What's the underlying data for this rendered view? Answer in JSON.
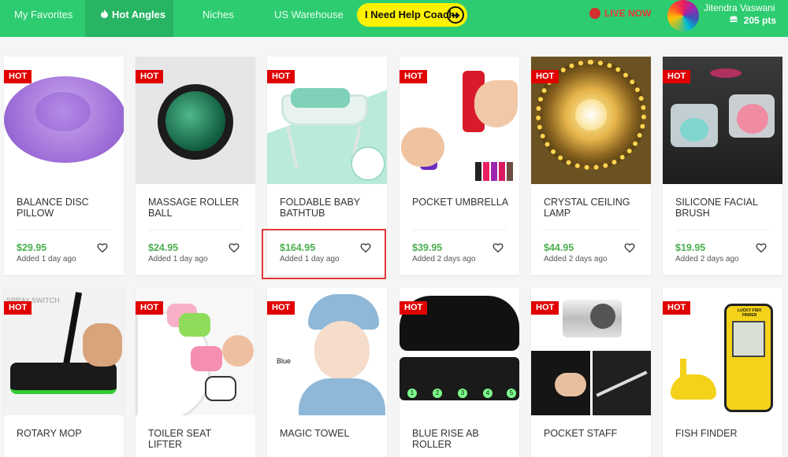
{
  "nav": {
    "tabs": [
      {
        "label": "My Favorites",
        "icon": ""
      },
      {
        "label": "Hot Angles",
        "icon": "fire-icon"
      },
      {
        "label": "Niches",
        "icon": ""
      },
      {
        "label": "US Warehouse",
        "icon": ""
      }
    ],
    "help_label": "I Need Help Coach",
    "live_label": "LIVE NOW",
    "user_name": "Jitendra Vaswani",
    "user_points": "205 pts"
  },
  "products": [
    {
      "title": "BALANCE DISC PILLOW",
      "price": "$29.95",
      "added": "Added 1 day ago",
      "hot": "HOT"
    },
    {
      "title": "MASSAGE ROLLER BALL",
      "price": "$24.95",
      "added": "Added 1 day ago",
      "hot": "HOT"
    },
    {
      "title": "FOLDABLE BABY BATHTUB",
      "price": "$164.95",
      "added": "Added 1 day ago",
      "hot": "HOT"
    },
    {
      "title": "POCKET UMBRELLA",
      "price": "$39.95",
      "added": "Added 2 days ago",
      "hot": "HOT"
    },
    {
      "title": "CRYSTAL CEILING LAMP",
      "price": "$44.95",
      "added": "Added 2 days ago",
      "hot": "HOT"
    },
    {
      "title": "SILICONE FACIAL BRUSH",
      "price": "$19.95",
      "added": "Added 2 days ago",
      "hot": "HOT"
    },
    {
      "title": "ROTARY MOP",
      "hot": "HOT",
      "img_text": "SPRAY SWITCH"
    },
    {
      "title": "TOILER SEAT LIFTER",
      "hot": "HOT"
    },
    {
      "title": "MAGIC TOWEL",
      "hot": "HOT",
      "img_text": "Blue"
    },
    {
      "title": "BLUE RISE AB ROLLER",
      "hot": "HOT",
      "img_numbers": [
        "1",
        "2",
        "3",
        "4",
        "5"
      ]
    },
    {
      "title": "POCKET STAFF",
      "hot": "HOT"
    },
    {
      "title": "FISH FINDER",
      "hot": "HOT",
      "img_text": "LUCKY FISH FINDER"
    }
  ],
  "colors": {
    "nav": "#2ecc71",
    "price": "#4caf50",
    "hot": "#e00000",
    "highlight": "#e53935"
  }
}
